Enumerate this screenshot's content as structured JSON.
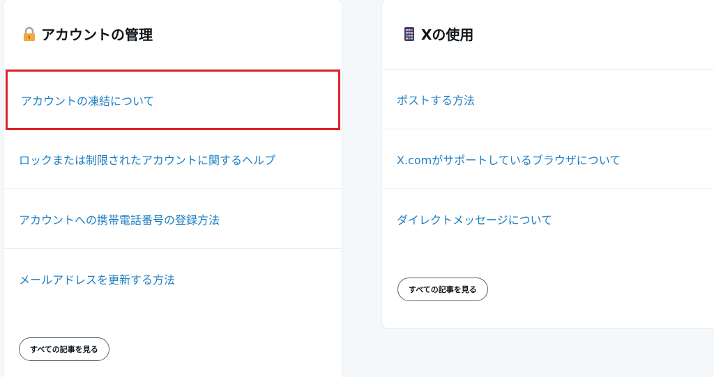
{
  "left_card": {
    "title": "アカウントの管理",
    "icon": "lock-icon",
    "items": [
      {
        "label": "アカウントの凍結について",
        "highlighted": true
      },
      {
        "label": "ロックまたは制限されたアカウントに関するヘルプ"
      },
      {
        "label": "アカウントへの携帯電話番号の登録方法"
      },
      {
        "label": "メールアドレスを更新する方法"
      }
    ],
    "see_all": "すべての記事を見る"
  },
  "right_card": {
    "title": "Xの使用",
    "icon": "phone-icon",
    "items": [
      {
        "label": "ポストする方法"
      },
      {
        "label": "X.comがサポートしているブラウザについて"
      },
      {
        "label": "ダイレクトメッセージについて"
      }
    ],
    "see_all": "すべての記事を見る"
  },
  "colors": {
    "link": "#1d7fc4",
    "highlight": "#e0222a",
    "background": "#f5f8fa",
    "card": "#ffffff"
  }
}
